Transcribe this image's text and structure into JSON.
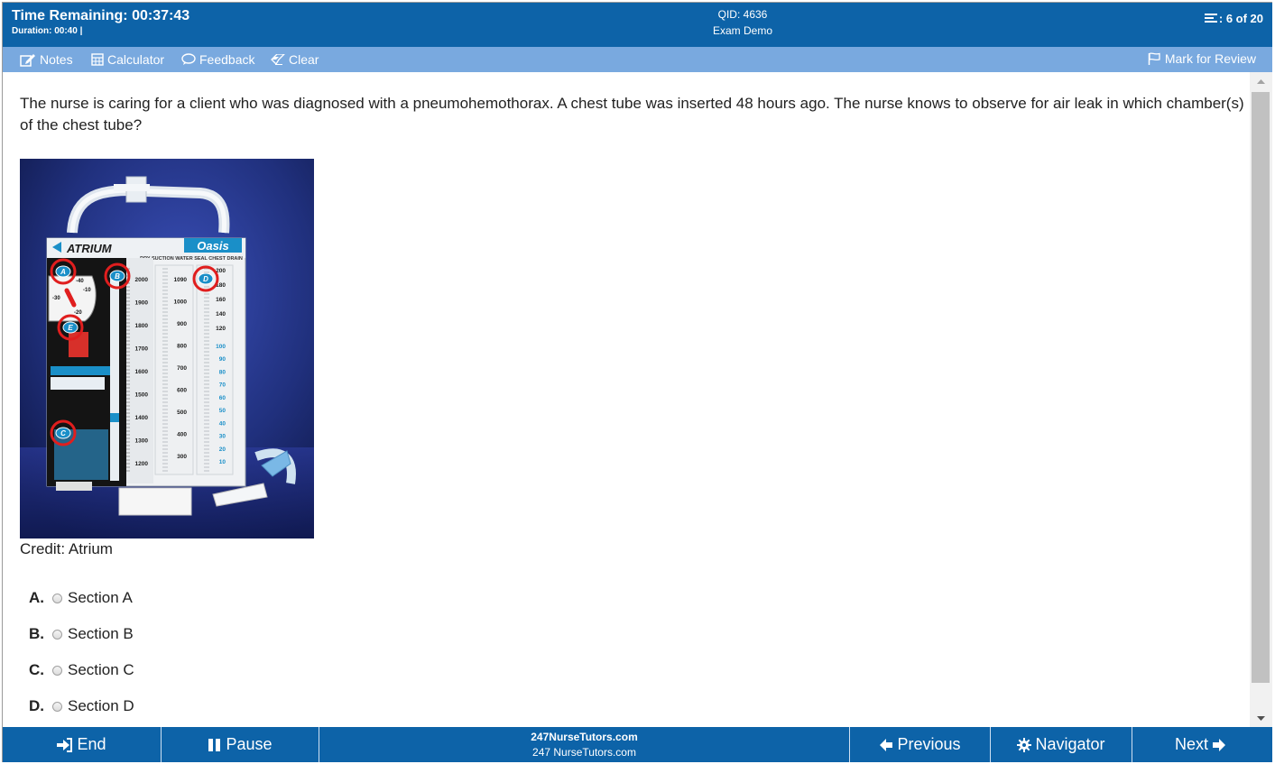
{
  "header": {
    "time_remaining": "Time Remaining: 00:37:43",
    "duration": "Duration: 00:40 |",
    "qid": "QID: 4636",
    "exam_name": "Exam Demo",
    "progress": "6 of 20",
    "progress_icon": "list-icon"
  },
  "toolbar": {
    "notes": "Notes",
    "calculator": "Calculator",
    "feedback": "Feedback",
    "clear": "Clear",
    "mark_for_review": "Mark for Review"
  },
  "question": {
    "text": "The nurse is caring for a client who was diagnosed with a pneumohemothorax. A chest tube was inserted 48 hours ago. The nurse knows to observe for air leak in which chamber(s) of the chest tube?",
    "credit": "Credit: Atrium",
    "image": {
      "brand": "ATRIUM",
      "product": "Oasis",
      "subtitle": "DRY SUCTION WATER SEAL CHEST DRAIN",
      "markers": [
        "A",
        "B",
        "C",
        "D",
        "E"
      ],
      "left_scale": [
        "2000",
        "1900",
        "1800",
        "1700",
        "1600",
        "1500",
        "1400",
        "1300",
        "1200"
      ],
      "middle_scale": [
        "1090",
        "1000",
        "900",
        "800",
        "700",
        "600",
        "500",
        "400",
        "300"
      ],
      "right_scale_black": [
        "200",
        "180",
        "160",
        "140",
        "120"
      ],
      "right_scale_blue": [
        "100",
        "90",
        "80",
        "70",
        "60",
        "50",
        "40",
        "30",
        "20",
        "10"
      ],
      "dial_labels": [
        "-40",
        "-10",
        "-30",
        "-20"
      ]
    },
    "choices": [
      {
        "letter": "A.",
        "label": "Section A"
      },
      {
        "letter": "B.",
        "label": "Section B"
      },
      {
        "letter": "C.",
        "label": "Section C"
      },
      {
        "letter": "D.",
        "label": "Section D"
      }
    ]
  },
  "footer": {
    "end": "End",
    "pause": "Pause",
    "site_bold": "247NurseTutors.com",
    "site": "247 NurseTutors.com",
    "previous": "Previous",
    "navigator": "Navigator",
    "next": "Next"
  },
  "colors": {
    "header_blue": "#0d63a8",
    "toolbar_blue": "#79a9df",
    "marker_red": "#e01e1e",
    "device_blue": "#1a8fc8"
  }
}
